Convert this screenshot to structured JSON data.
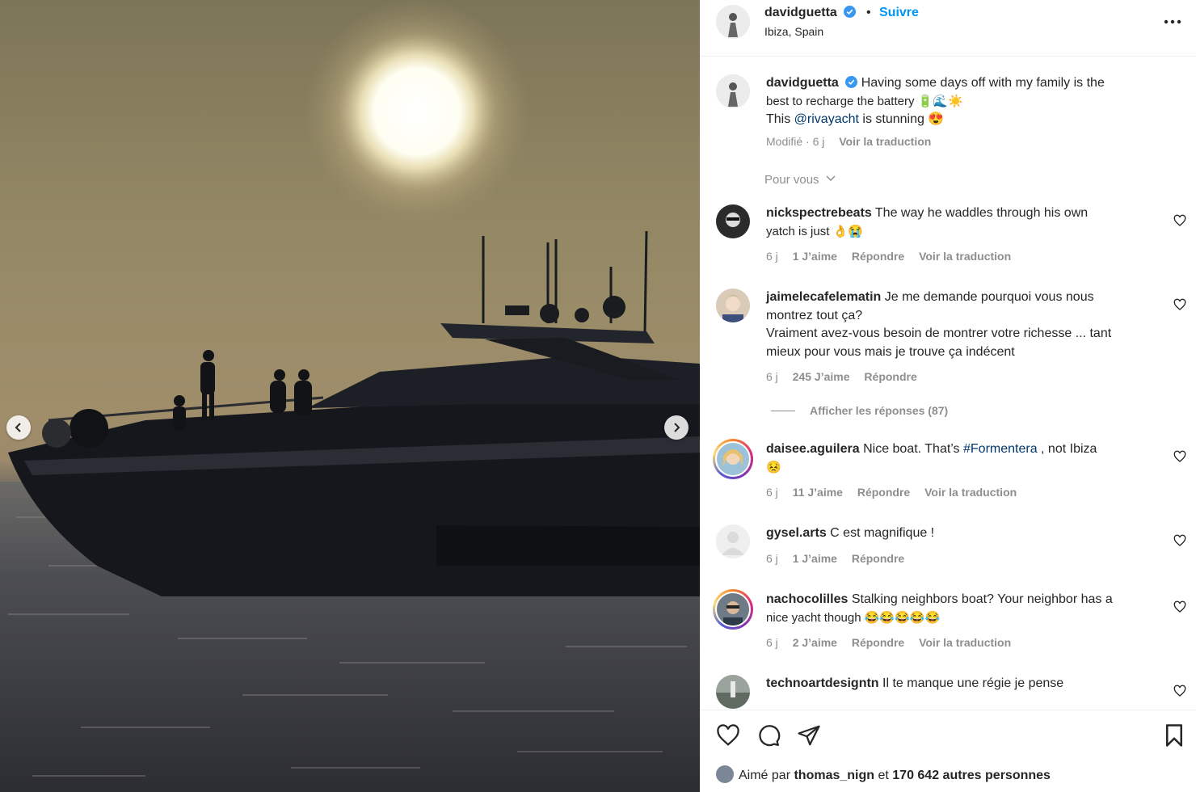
{
  "post": {
    "username": "davidguetta",
    "follow_label": "Suivre",
    "dot": "•",
    "location": "Ibiza, Spain",
    "caption_line1": "Having some days off with my family is the",
    "caption_line2": "best to recharge the battery 🔋🌊☀️",
    "caption_line3_pre": "This ",
    "caption_mention": "@rivayacht",
    "caption_line3_post": " is stunning 😍",
    "caption_meta_time": "Modifié · 6 j",
    "translate_label": "Voir la traduction"
  },
  "filter_label": "Pour vous",
  "comments": [
    {
      "user": "nickspectrebeats",
      "line1": "The way he waddles through his own",
      "line2": "yatch is just 👌😭",
      "time": "6 j",
      "likes": "1 J’aime",
      "reply": "Répondre",
      "translate": "Voir la traduction"
    },
    {
      "user": "jaimelecafelematin",
      "line1": "Je me demande pourquoi vous nous",
      "line2": "montrez tout ça?",
      "line3": "Vraiment avez-vous besoin de montrer votre richesse ... tant",
      "line4": "mieux pour vous mais je trouve ça indécent",
      "time": "6 j",
      "likes": "245 J’aime",
      "reply": "Répondre",
      "view_replies": "Afficher les réponses (87)"
    },
    {
      "user": "daisee.aguilera",
      "line1_pre": "Nice boat. That’s ",
      "hashtag": "#Formentera",
      "line1_post": " , not Ibiza",
      "line2": "😣",
      "time": "6 j",
      "likes": "11 J’aime",
      "reply": "Répondre",
      "translate": "Voir la traduction"
    },
    {
      "user": "gysel.arts",
      "line1": "C est magnifique !",
      "time": "6 j",
      "likes": "1 J’aime",
      "reply": "Répondre"
    },
    {
      "user": "nachocolilles",
      "line1": "Stalking neighbors boat? Your neighbor has a",
      "line2": "nice yacht though 😂😂😂😂😂",
      "time": "6 j",
      "likes": "2 J’aime",
      "reply": "Répondre",
      "translate": "Voir la traduction"
    },
    {
      "user": "technoartdesigntn",
      "line1": "Il te manque une régie je pense"
    }
  ],
  "likes_bar": {
    "prefix": "Aimé par ",
    "user": "thomas_nign",
    "middle": " et ",
    "count": "170 642 autres personnes"
  },
  "colors": {
    "accent": "#0095f6",
    "verified": "#3897f0",
    "link": "#00376b",
    "muted": "#8e8e8e"
  }
}
